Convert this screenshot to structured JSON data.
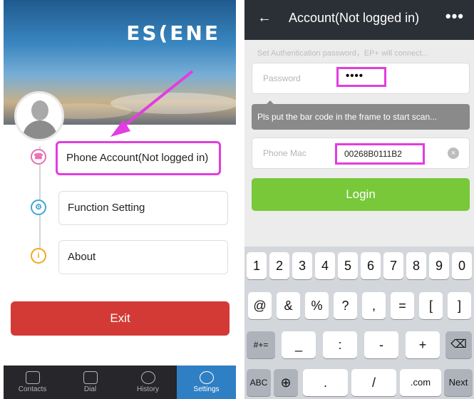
{
  "left": {
    "logo": "ES(ENE",
    "menu": {
      "phone_account": "Phone Account(Not logged in)",
      "function_setting": "Function Setting",
      "about": "About"
    },
    "exit": "Exit",
    "nav": {
      "contacts": "Contacts",
      "dial": "Dial",
      "history": "History",
      "settings": "Settings"
    }
  },
  "right": {
    "title": "Account(Not logged in)",
    "back_icon": "←",
    "more_icon": "•••",
    "hint": "Set Authentication password，EP+ will connect...",
    "password_label": "Password",
    "password_value": "••••",
    "tooltip": "Pls put the bar code in the frame to start scan...",
    "mac_label": "Phone Mac",
    "mac_value": "00268B0111B2",
    "clear_icon": "×",
    "login": "Login",
    "keyboard": {
      "row1": [
        "1",
        "2",
        "3",
        "4",
        "5",
        "6",
        "7",
        "8",
        "9",
        "0"
      ],
      "row2": [
        "@",
        "&",
        "%",
        "?",
        ",",
        "=",
        "[",
        "]"
      ],
      "row3_left": "#+=",
      "row3": [
        "_",
        ":",
        "-",
        "+"
      ],
      "row3_right": "⌫",
      "row4": {
        "abc": "ABC",
        "globe": "⊕",
        "dot": ".",
        "slash": "/",
        "com": ".com",
        "next": "Next"
      }
    }
  },
  "colors": {
    "highlight": "#e23de0",
    "exit": "#d33a35",
    "login": "#78c83a",
    "nav_active": "#2f7fc4"
  }
}
